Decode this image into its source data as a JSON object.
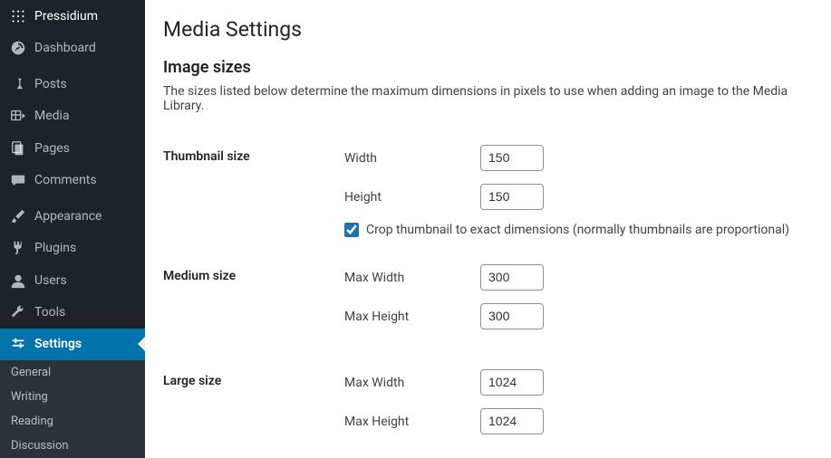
{
  "sidebar": {
    "brand": "Pressidium",
    "items": [
      {
        "label": "Dashboard"
      },
      {
        "label": "Posts"
      },
      {
        "label": "Media"
      },
      {
        "label": "Pages"
      },
      {
        "label": "Comments"
      },
      {
        "label": "Appearance"
      },
      {
        "label": "Plugins"
      },
      {
        "label": "Users"
      },
      {
        "label": "Tools"
      },
      {
        "label": "Settings"
      }
    ],
    "submenu": [
      "General",
      "Writing",
      "Reading",
      "Discussion"
    ]
  },
  "page": {
    "title": "Media Settings",
    "section_title": "Image sizes",
    "section_desc": "The sizes listed below determine the maximum dimensions in pixels to use when adding an image to the Media Library."
  },
  "thumbnail": {
    "heading": "Thumbnail size",
    "width_label": "Width",
    "width_value": "150",
    "height_label": "Height",
    "height_value": "150",
    "crop_label": "Crop thumbnail to exact dimensions (normally thumbnails are proportional)",
    "crop_checked": true
  },
  "medium": {
    "heading": "Medium size",
    "width_label": "Max Width",
    "width_value": "300",
    "height_label": "Max Height",
    "height_value": "300"
  },
  "large": {
    "heading": "Large size",
    "width_label": "Max Width",
    "width_value": "1024",
    "height_label": "Max Height",
    "height_value": "1024"
  }
}
